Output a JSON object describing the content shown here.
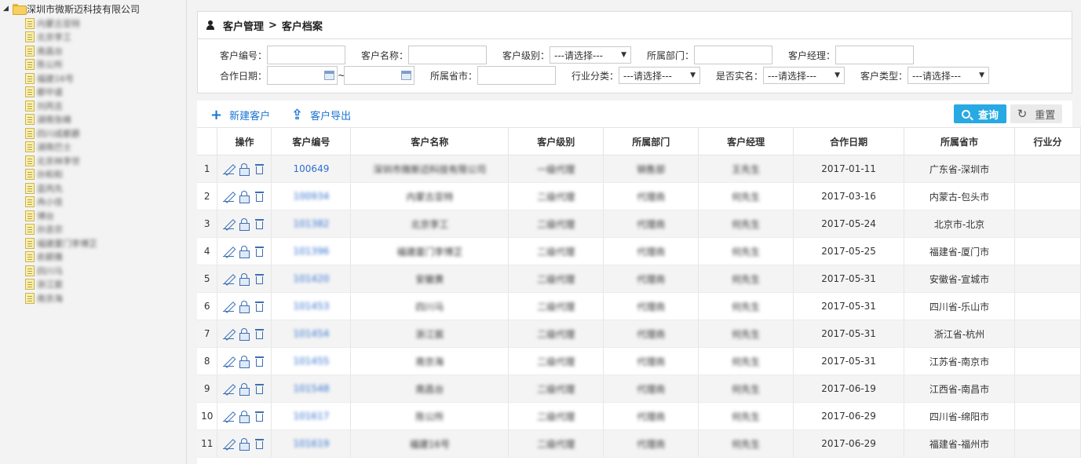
{
  "sidebar": {
    "root_label": "深圳市微斯迈科技有限公司",
    "items": [
      "内蒙古亚特",
      "北京李工",
      "南昌台",
      "陈公所",
      "福建16号",
      "都中道",
      "刘丙吉",
      "湖南张峰",
      "四川成都爵",
      "湖南巴士",
      "北京林李世",
      "孙和和",
      "蓝丙先",
      "冉小佳",
      "博台",
      "孙丞宗",
      "福建厦门李博芷",
      "俞颖雅",
      "四川马",
      "浙江宸",
      "南京海"
    ]
  },
  "breadcrumb": {
    "module": "客户管理",
    "separator": ">",
    "page": "客户档案"
  },
  "filters": {
    "row1": {
      "customer_code": "客户编号：",
      "customer_name": "客户名称：",
      "customer_level": "客户级别：",
      "department": "所属部门：",
      "manager": "客户经理："
    },
    "row2": {
      "coop_date": "合作日期：",
      "province": "所属省市：",
      "industry": "行业分类：",
      "real_name": "是否实名：",
      "customer_type": "客户类型："
    },
    "select_placeholder": "---请选择---",
    "date_separator": "~"
  },
  "toolbar": {
    "new_label": "新建客户",
    "export_label": "客户导出",
    "search_label": "查询",
    "reset_label": "重置"
  },
  "table": {
    "headers": [
      "操作",
      "客户编号",
      "客户名称",
      "客户级别",
      "所属部门",
      "客户经理",
      "合作日期",
      "所属省市",
      "行业分"
    ],
    "rows": [
      {
        "idx": "1",
        "code": "100649",
        "name": "深圳市微斯迈科技有限公司",
        "level": "一级代理",
        "dept": "销售部",
        "manager": "王先生",
        "date": "2017-01-11",
        "region": "广东省-深圳市"
      },
      {
        "idx": "2",
        "code": "100934",
        "name": "内蒙古亚特",
        "level": "二级代理",
        "dept": "代理商",
        "manager": "何先生",
        "date": "2017-03-16",
        "region": "内蒙古-包头市"
      },
      {
        "idx": "3",
        "code": "101382",
        "name": "北京李工",
        "level": "二级代理",
        "dept": "代理商",
        "manager": "何先生",
        "date": "2017-05-24",
        "region": "北京市-北京"
      },
      {
        "idx": "4",
        "code": "101396",
        "name": "福建厦门李博芷",
        "level": "二级代理",
        "dept": "代理商",
        "manager": "何先生",
        "date": "2017-05-25",
        "region": "福建省-厦门市"
      },
      {
        "idx": "5",
        "code": "101420",
        "name": "安徽黄",
        "level": "二级代理",
        "dept": "代理商",
        "manager": "何先生",
        "date": "2017-05-31",
        "region": "安徽省-宣城市"
      },
      {
        "idx": "6",
        "code": "101453",
        "name": "四川马",
        "level": "二级代理",
        "dept": "代理商",
        "manager": "何先生",
        "date": "2017-05-31",
        "region": "四川省-乐山市"
      },
      {
        "idx": "7",
        "code": "101454",
        "name": "浙江宸",
        "level": "二级代理",
        "dept": "代理商",
        "manager": "何先生",
        "date": "2017-05-31",
        "region": "浙江省-杭州"
      },
      {
        "idx": "8",
        "code": "101455",
        "name": "南京海",
        "level": "二级代理",
        "dept": "代理商",
        "manager": "何先生",
        "date": "2017-05-31",
        "region": "江苏省-南京市"
      },
      {
        "idx": "9",
        "code": "101548",
        "name": "南昌台",
        "level": "二级代理",
        "dept": "代理商",
        "manager": "何先生",
        "date": "2017-06-19",
        "region": "江西省-南昌市"
      },
      {
        "idx": "10",
        "code": "101617",
        "name": "陈公所",
        "level": "二级代理",
        "dept": "代理商",
        "manager": "何先生",
        "date": "2017-06-29",
        "region": "四川省-绵阳市"
      },
      {
        "idx": "11",
        "code": "101619",
        "name": "福建16号",
        "level": "二级代理",
        "dept": "代理商",
        "manager": "何先生",
        "date": "2017-06-29",
        "region": "福建省-福州市"
      }
    ]
  },
  "colors": {
    "accent": "#27a9e3",
    "link": "#1a73d2",
    "code_link": "#2f6fd0"
  },
  "icons": [
    "user-icon",
    "add-icon",
    "export-icon",
    "search-icon",
    "reset-icon",
    "edit-icon",
    "lock-icon",
    "trash-icon",
    "calendar-icon",
    "folder-icon",
    "document-icon"
  ]
}
